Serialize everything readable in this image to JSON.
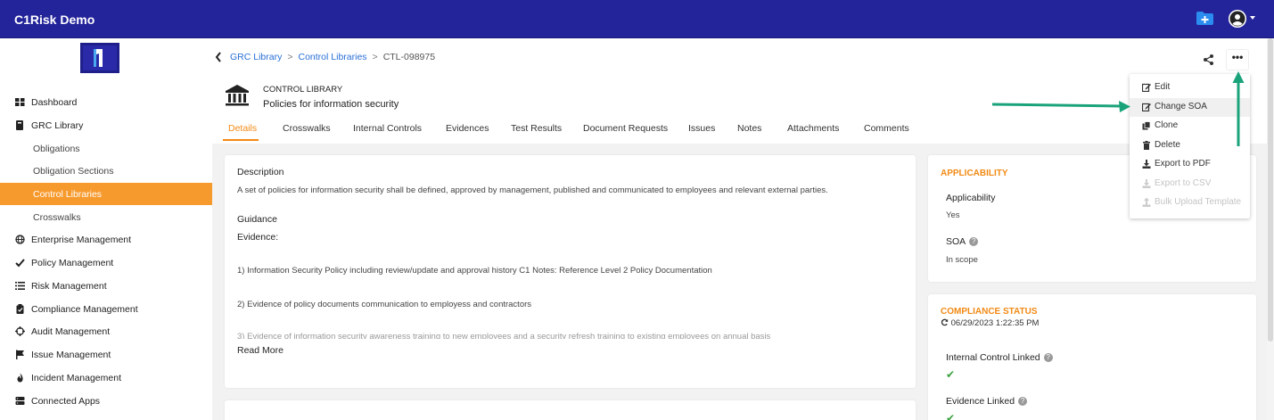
{
  "app": {
    "title": "C1Risk Demo"
  },
  "sidebar": {
    "items": [
      {
        "label": "Dashboard",
        "icon": "grid-icon"
      },
      {
        "label": "GRC Library",
        "icon": "book-icon"
      },
      {
        "label": "Obligations"
      },
      {
        "label": "Obligation Sections"
      },
      {
        "label": "Control Libraries",
        "active": true
      },
      {
        "label": "Crosswalks"
      },
      {
        "label": "Enterprise Management",
        "icon": "globe-icon"
      },
      {
        "label": "Policy Management",
        "icon": "check-icon"
      },
      {
        "label": "Risk Management",
        "icon": "list-icon"
      },
      {
        "label": "Compliance Management",
        "icon": "clipboard-icon"
      },
      {
        "label": "Audit Management",
        "icon": "crosshair-icon"
      },
      {
        "label": "Issue Management",
        "icon": "flag-icon"
      },
      {
        "label": "Incident Management",
        "icon": "fire-icon"
      },
      {
        "label": "Connected Apps",
        "icon": "stack-icon"
      }
    ]
  },
  "breadcrumb": {
    "items": [
      "GRC Library",
      "Control Libraries"
    ],
    "current": "CTL-098975"
  },
  "record": {
    "type": "CONTROL LIBRARY",
    "title": "Policies for information security"
  },
  "more_menu_label": "•••",
  "tabs": [
    "Details",
    "Crosswalks",
    "Internal Controls",
    "Evidences",
    "Test Results",
    "Document Requests",
    "Issues",
    "Notes",
    "Attachments",
    "Comments"
  ],
  "details": {
    "description_label": "Description",
    "description_text": "A set of policies for information security shall be defined, approved by management, published and communicated to employees and relevant external parties.",
    "guidance_label": "Guidance",
    "evidence_label": "Evidence:",
    "evidence_items": [
      "1) Information Security Policy including review/update and approval history C1 Notes: Reference Level 2 Policy Documentation",
      "2) Evidence of policy documents communication to employess and contractors",
      "3) Evidence of information security awareness training to new employees and a security refresh training to existing employees on annual basis"
    ],
    "read_more": "Read More"
  },
  "applicability": {
    "title": "APPLICABILITY",
    "applicability_label": "Applicability",
    "applicability_value": "Yes",
    "soa_label": "SOA",
    "soa_value": "In scope"
  },
  "compliance": {
    "title": "COMPLIANCE STATUS",
    "timestamp": "06/29/2023 1:22:35 PM",
    "internal_control_label": "Internal Control Linked",
    "evidence_linked_label": "Evidence Linked"
  },
  "dropdown": {
    "items": [
      {
        "label": "Edit",
        "icon": "edit-icon"
      },
      {
        "label": "Change SOA",
        "icon": "edit-icon",
        "hover": true
      },
      {
        "label": "Clone",
        "icon": "copy-icon"
      },
      {
        "label": "Delete",
        "icon": "trash-icon"
      },
      {
        "label": "Export to PDF",
        "icon": "download-icon"
      },
      {
        "label": "Export to CSV",
        "icon": "download-icon",
        "disabled": true
      },
      {
        "label": "Bulk Upload Template",
        "icon": "upload-icon",
        "disabled": true
      }
    ]
  },
  "colors": {
    "topbar": "#23239a",
    "accent": "#f28a14",
    "active_nav": "#f79a2e",
    "link": "#2a6fd6",
    "annotation_arrow": "#1aa37a",
    "check": "#38a13d"
  }
}
